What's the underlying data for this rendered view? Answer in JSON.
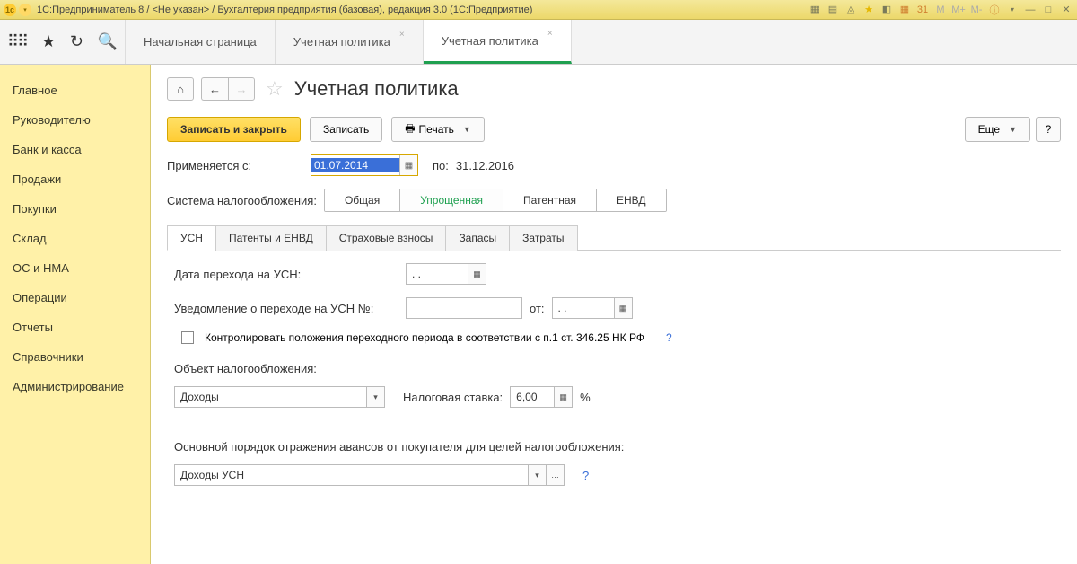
{
  "titlebar": {
    "text": "1С:Предприниматель 8 / <Не указан> / Бухгалтерия предприятия (базовая), редакция 3.0  (1С:Предприятие)"
  },
  "toolbar_tabs": [
    {
      "label": "Начальная страница",
      "active": false
    },
    {
      "label": "Учетная политика",
      "active": false
    },
    {
      "label": "Учетная политика",
      "active": true
    }
  ],
  "sidebar": {
    "items": [
      "Главное",
      "Руководителю",
      "Банк и касса",
      "Продажи",
      "Покупки",
      "Склад",
      "ОС и НМА",
      "Операции",
      "Отчеты",
      "Справочники",
      "Администрирование"
    ]
  },
  "page": {
    "title": "Учетная политика",
    "save_close": "Записать и закрыть",
    "save": "Записать",
    "print": "Печать",
    "more": "Еще"
  },
  "form": {
    "applies_from_label": "Применяется с:",
    "applies_from_value": "01.07.2014",
    "to_label": "по:",
    "to_value": "31.12.2016",
    "tax_system_label": "Система налогообложения:",
    "tax_options": [
      "Общая",
      "Упрощенная",
      "Патентная",
      "ЕНВД"
    ],
    "tax_active": "Упрощенная"
  },
  "inner_tabs": [
    "УСН",
    "Патенты и ЕНВД",
    "Страховые взносы",
    "Запасы",
    "Затраты"
  ],
  "inner_active": "УСН",
  "usn": {
    "transition_date_label": "Дата перехода на УСН:",
    "transition_date_value": ". .",
    "notice_label": "Уведомление о переходе на УСН №:",
    "notice_from": "от:",
    "notice_date_value": ". .",
    "checkbox_label": "Контролировать положения переходного периода в соответствии с п.1 ст. 346.25 НК РФ",
    "object_label": "Объект налогообложения:",
    "object_value": "Доходы",
    "rate_label": "Налоговая ставка:",
    "rate_value": "6,00",
    "rate_unit": "%",
    "advance_label": "Основной порядок отражения авансов от покупателя для целей налогообложения:",
    "advance_value": "Доходы УСН"
  }
}
